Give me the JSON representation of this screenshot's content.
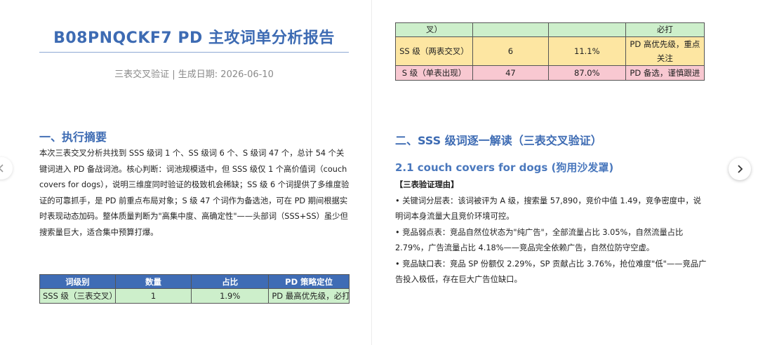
{
  "document": {
    "title": "B08PNQCKF7 PD 主攻词单分析报告",
    "subtitle": "三表交叉验证 | 生成日期: 2026-06-10"
  },
  "summary": {
    "heading": "一、执行摘要",
    "text": "本次三表交叉分析共找到 SSS 级词 1 个、SS 级词 6 个、S 级词 47 个，总计 54 个关键词进入 PD 备战词池。核心判断：词池规模适中，但 SSS 级仅 1 个高价值词（couch covers for dogs），说明三维度同时验证的极致机会稀缺；SS 级 6 个词提供了多维度验证的可靠抓手，是 PD 前重点布局对象；S 级 47 个词作为备选池，可在 PD 期间根据实时表现动态加码。整体质量判断为\"高集中度、高确定性\"——头部词（SSS+SS）虽少但搜索量巨大，适合集中预算打爆。"
  },
  "tier_table": {
    "headers": [
      "词级别",
      "数量",
      "占比",
      "PD 策略定位"
    ],
    "rows": [
      [
        "SSS 级（三表交叉）",
        "1",
        "1.9%",
        "PD 最高优先级，必打"
      ],
      [
        "SS 级（两表交叉）",
        "6",
        "11.1%",
        "PD 高优先级，重点关注"
      ],
      [
        "S 级（单表出现）",
        "47",
        "87.0%",
        "PD 备选，谨慎跟进"
      ]
    ],
    "row_colors": [
      "#cdefcb",
      "#fde6a2",
      "#f8c8d1"
    ],
    "continued": {
      "first_row": [
        "叉）",
        "",
        "",
        "必打"
      ]
    }
  },
  "section2": {
    "heading": "二、SSS 级词逐一解读（三表交叉验证）",
    "sub_heading": "2.1 couch covers for dogs (狗用沙发罩)",
    "tag": "【三表验证理由】",
    "bullets": [
      "• 关键词分层表：该词被评为 A 级，搜索量 57,890，竞价中值 1.49，竞争密度中，说明词本身流量大且竞价环境可控。",
      "• 竞品弱点表：竞品自然位状态为\"纯广告\"，全部流量占比 3.05%，自然流量占比 2.79%，广告流量占比 4.18%——竞品完全依赖广告，自然位防守空虚。",
      "• 竞品缺口表：竞品 SP 份额仅 2.29%，SP 贡献占比 3.76%，抢位难度\"低\"——竞品广告投入极低，存在巨大广告位缺口。"
    ]
  },
  "colors": {
    "heading_blue": "#3d6bb3",
    "table_header": "#3f6cb5"
  },
  "icons": {
    "prev": "chevron-left-icon",
    "next": "chevron-right-icon"
  }
}
